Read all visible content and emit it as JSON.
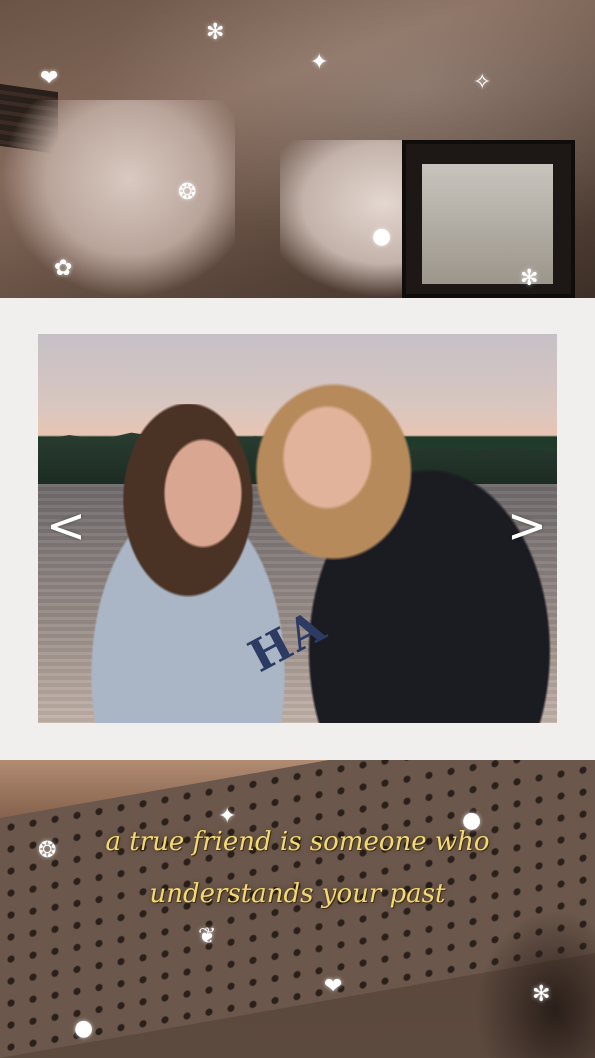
{
  "story": {
    "nav": {
      "prev_label": "<",
      "next_label": ">"
    },
    "photo": {
      "hoodie_text": "HA"
    },
    "quote": {
      "line1": "a true friend is someone who",
      "line2": "understands your past"
    }
  },
  "decorations": {
    "sparkle_icon": "sparkle-icon",
    "sparkle_color": "#ffffff",
    "quote_color": "#f2d970",
    "card_color": "#f0efed"
  }
}
